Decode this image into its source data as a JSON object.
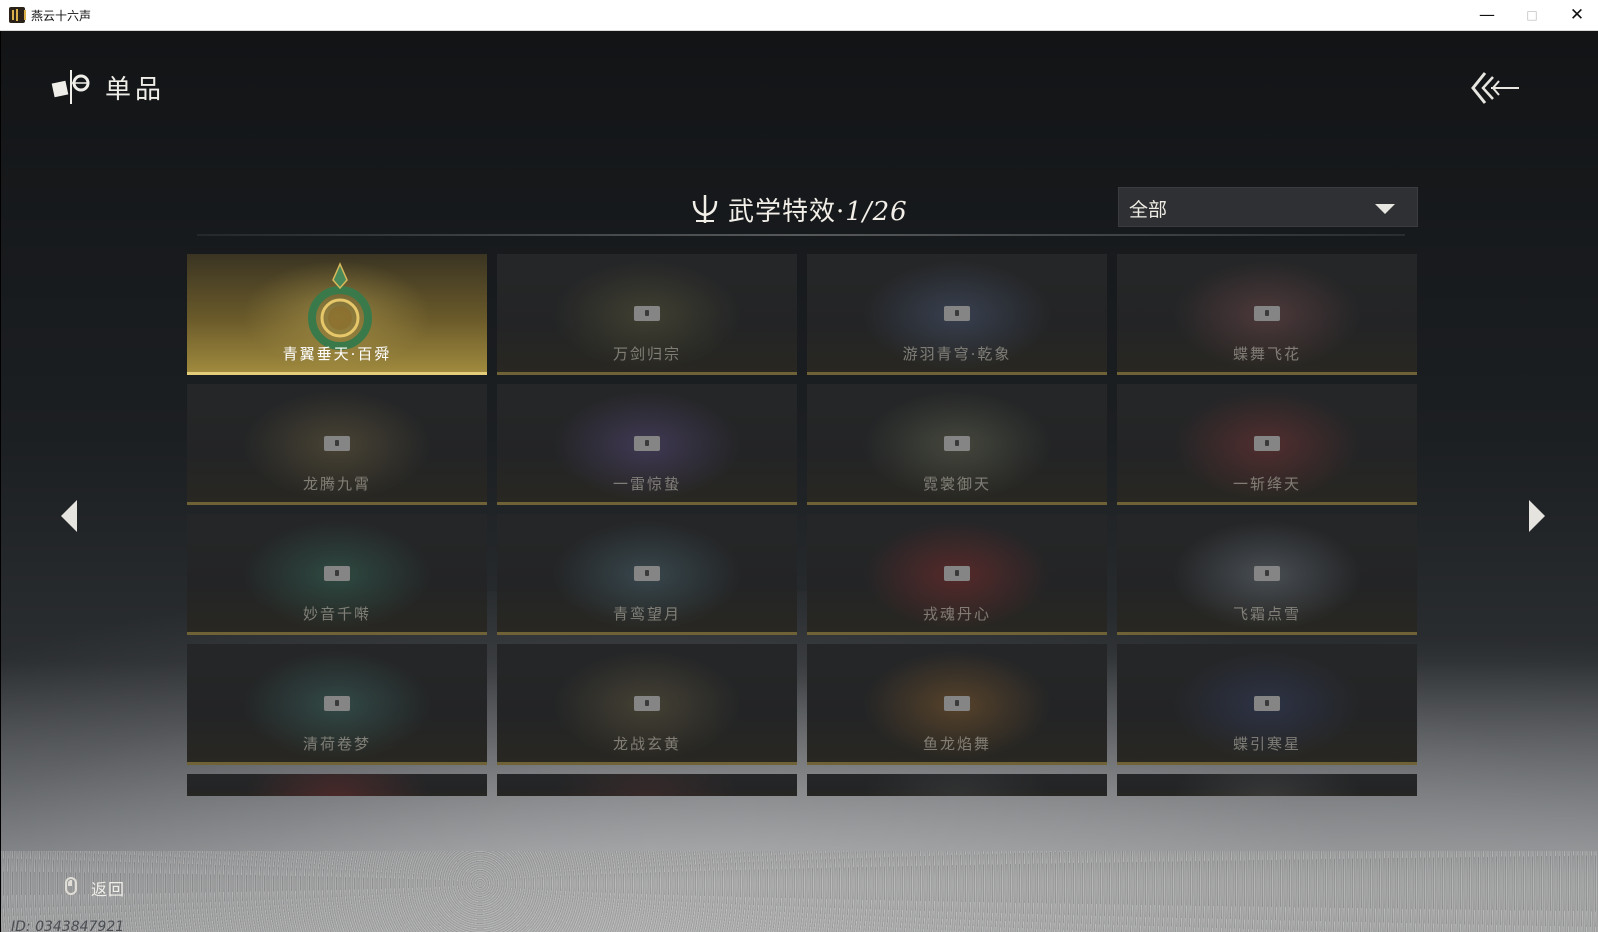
{
  "window": {
    "title": "燕云十六声",
    "controls": {
      "minimize": "—",
      "maximize": "□",
      "close": "✕"
    }
  },
  "header": {
    "title": "单品",
    "icon": "shop-icon",
    "back_icon": "triple-chevron-back-icon"
  },
  "section": {
    "title": "武学特效·",
    "count": "1/26",
    "icon": "trident-icon"
  },
  "filter": {
    "selected": "全部"
  },
  "colors": {
    "selected_gold": "#e3cc7a",
    "card_border": "#6f6236",
    "card_bg": "#2a2c2e"
  },
  "cards": [
    {
      "name": "青翼垂天·百舜",
      "state": "selected",
      "fx_color": "#c9b25a"
    },
    {
      "name": "万剑归宗",
      "state": "locked",
      "fx_color": "#8a8552"
    },
    {
      "name": "游羽青穹·乾象",
      "state": "locked",
      "fx_color": "#6f86b8"
    },
    {
      "name": "蝶舞飞花",
      "state": "locked",
      "fx_color": "#b86f72"
    },
    {
      "name": "龙腾九霄",
      "state": "locked",
      "fx_color": "#a8925a"
    },
    {
      "name": "一雷惊蛰",
      "state": "locked",
      "fx_color": "#8a6fc8"
    },
    {
      "name": "霓裳御天",
      "state": "locked",
      "fx_color": "#9aa07a"
    },
    {
      "name": "一斩绛天",
      "state": "locked",
      "fx_color": "#c84a4a"
    },
    {
      "name": "妙音千啭",
      "state": "locked",
      "fx_color": "#4fa88a"
    },
    {
      "name": "青鸾望月",
      "state": "locked",
      "fx_color": "#6fa0b0"
    },
    {
      "name": "戎魂丹心",
      "state": "locked",
      "fx_color": "#d83a3a"
    },
    {
      "name": "飞霜点雪",
      "state": "locked",
      "fx_color": "#a8b8c8"
    },
    {
      "name": "清荷卷梦",
      "state": "locked",
      "fx_color": "#5aa89a"
    },
    {
      "name": "龙战玄黄",
      "state": "locked",
      "fx_color": "#9a8a5a"
    },
    {
      "name": "鱼龙焰舞",
      "state": "locked",
      "fx_color": "#d8903a"
    },
    {
      "name": "蝶引寒星",
      "state": "locked",
      "fx_color": "#4a5a98"
    }
  ],
  "partial_row": [
    {
      "fx_color": "#a83a3a"
    },
    {
      "fx_color": "#6a3a3a"
    },
    {
      "fx_color": "#5a5a5a"
    },
    {
      "fx_color": "#6a6a6a"
    }
  ],
  "footer": {
    "back_label": "返回",
    "id_text": "ID: 0343847921"
  }
}
